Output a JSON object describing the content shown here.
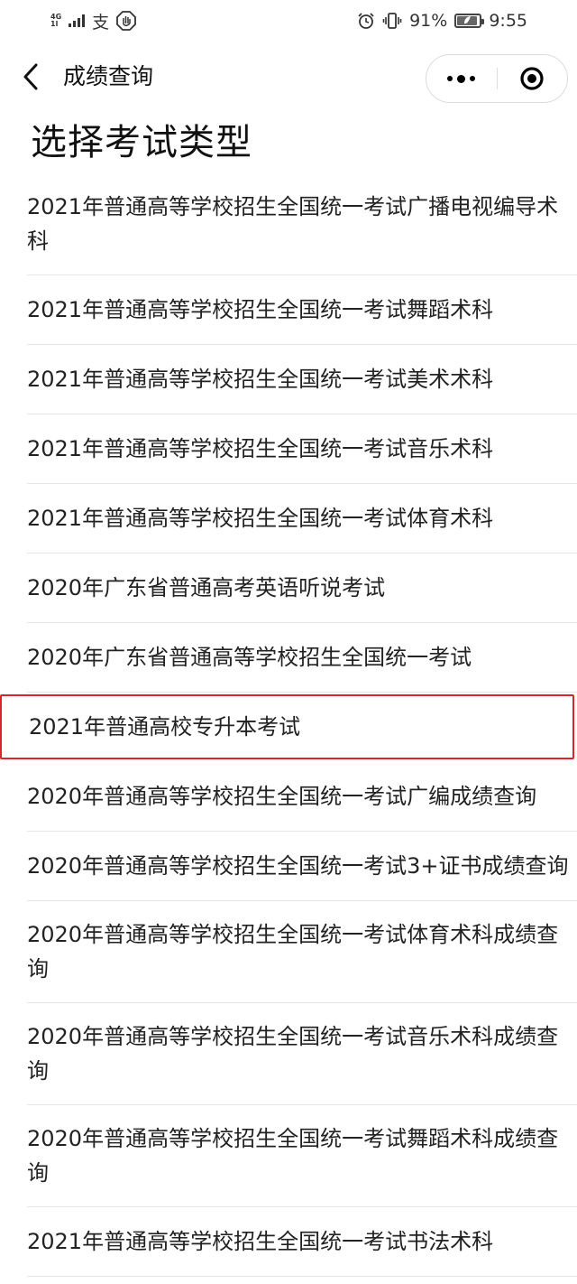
{
  "status_bar": {
    "network": "4G",
    "sub_network": "1l",
    "alipay_glyph": "支",
    "battery_percent": "91%",
    "battery_level": 0.91,
    "time": "9:55"
  },
  "nav": {
    "title": "成绩查询"
  },
  "page": {
    "heading": "选择考试类型"
  },
  "exams": [
    "2021年普通高等学校招生全国统一考试广播电视编导术科",
    "2021年普通高等学校招生全国统一考试舞蹈术科",
    "2021年普通高等学校招生全国统一考试美术术科",
    "2021年普通高等学校招生全国统一考试音乐术科",
    "2021年普通高等学校招生全国统一考试体育术科",
    "2020年广东省普通高考英语听说考试",
    "2020年广东省普通高等学校招生全国统一考试",
    "2021年普通高校专升本考试",
    "2020年普通高等学校招生全国统一考试广编成绩查询",
    "2020年普通高等学校招生全国统一考试3+证书成绩查询",
    "2020年普通高等学校招生全国统一考试体育术科成绩查询",
    "2020年普通高等学校招生全国统一考试音乐术科成绩查询",
    "2020年普通高等学校招生全国统一考试舞蹈术科成绩查询",
    "2021年普通高等学校招生全国统一考试书法术科"
  ],
  "colors": {
    "highlight_border": "#d9262a",
    "divider": "#e6e6e6",
    "text": "#222222"
  }
}
